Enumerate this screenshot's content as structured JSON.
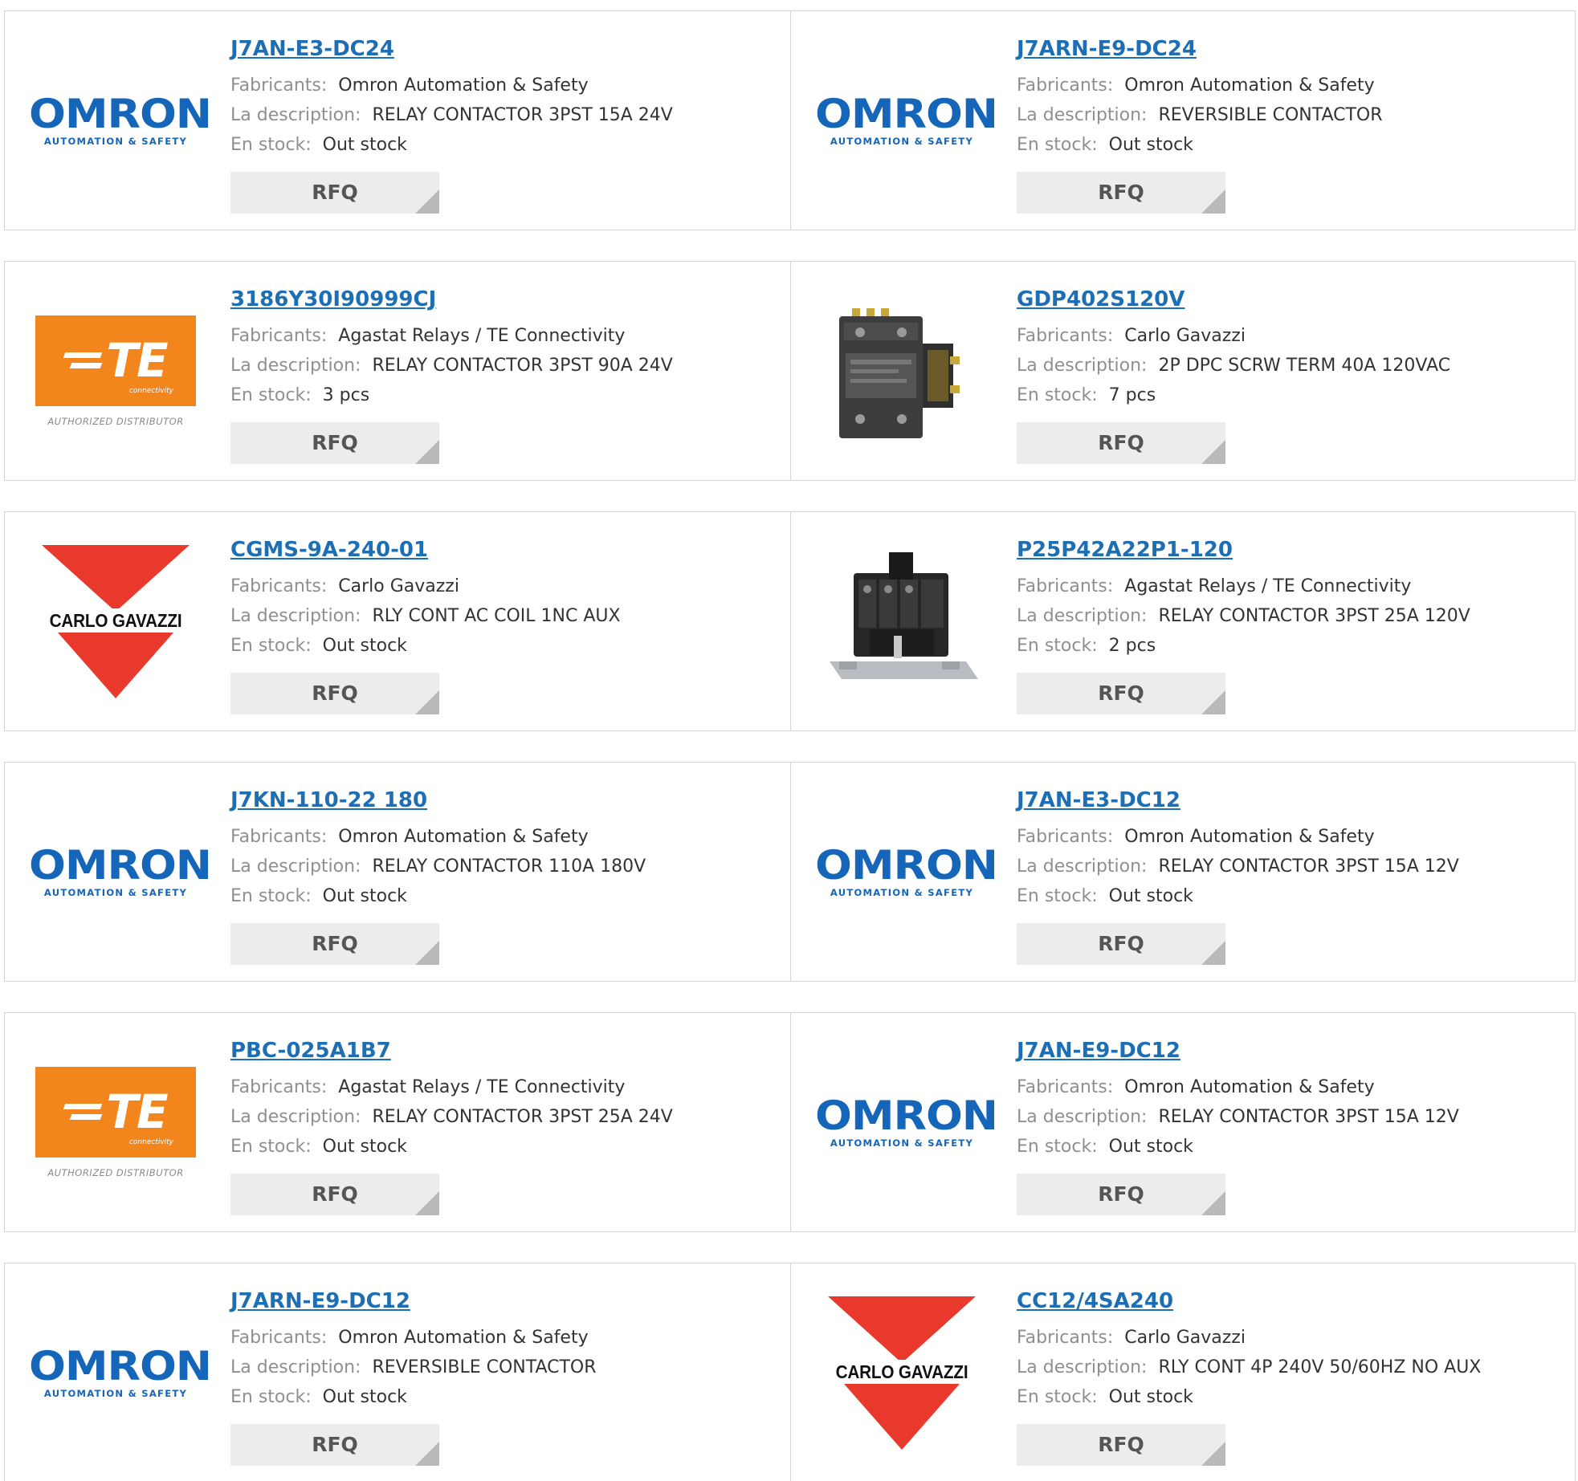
{
  "labels": {
    "manufacturer": "Fabricants:",
    "description": "La description:",
    "stock": "En stock:",
    "rfq": "RFQ"
  },
  "logos": {
    "omron": {
      "wordmark": "OMRON",
      "tagline": "AUTOMATION & SAFETY",
      "color": "#1565b9"
    },
    "te": {
      "mark": "TE",
      "tagline": "connectivity",
      "caption": "AUTHORIZED DISTRIBUTOR",
      "color": "#f3851d"
    },
    "carlo": {
      "name": "CARLO GAVAZZI",
      "color": "#e8392c"
    }
  },
  "accent_color": "#1e6eb4",
  "products": [
    {
      "part": "J7AN-E3-DC24",
      "manufacturer": "Omron Automation & Safety",
      "description": "RELAY CONTACTOR 3PST 15A 24V",
      "stock": "Out stock",
      "logo": "omron"
    },
    {
      "part": "J7ARN-E9-DC24",
      "manufacturer": "Omron Automation & Safety",
      "description": "REVERSIBLE CONTACTOR",
      "stock": "Out stock",
      "logo": "omron"
    },
    {
      "part": "3186Y30I90999CJ",
      "manufacturer": "Agastat Relays / TE Connectivity",
      "description": "RELAY CONTACTOR 3PST 90A 24V",
      "stock": "3 pcs",
      "logo": "te"
    },
    {
      "part": "GDP402S120V",
      "manufacturer": "Carlo Gavazzi",
      "description": "2P DPC SCRW TERM 40A 120VAC",
      "stock": "7 pcs",
      "logo": "photo-contactor-flat"
    },
    {
      "part": "CGMS-9A-240-01",
      "manufacturer": "Carlo Gavazzi",
      "description": "RLY CONT AC COIL 1NC AUX",
      "stock": "Out stock",
      "logo": "carlo"
    },
    {
      "part": "P25P42A22P1-120",
      "manufacturer": "Agastat Relays / TE Connectivity",
      "description": "RELAY CONTACTOR 3PST 25A 120V",
      "stock": "2 pcs",
      "logo": "photo-contactor-base"
    },
    {
      "part": "J7KN-110-22 180",
      "manufacturer": "Omron Automation & Safety",
      "description": "RELAY CONTACTOR 110A 180V",
      "stock": "Out stock",
      "logo": "omron"
    },
    {
      "part": "J7AN-E3-DC12",
      "manufacturer": "Omron Automation & Safety",
      "description": "RELAY CONTACTOR 3PST 15A 12V",
      "stock": "Out stock",
      "logo": "omron"
    },
    {
      "part": "PBC-025A1B7",
      "manufacturer": "Agastat Relays / TE Connectivity",
      "description": "RELAY CONTACTOR 3PST 25A 24V",
      "stock": "Out stock",
      "logo": "te"
    },
    {
      "part": "J7AN-E9-DC12",
      "manufacturer": "Omron Automation & Safety",
      "description": "RELAY CONTACTOR 3PST 15A 12V",
      "stock": "Out stock",
      "logo": "omron"
    },
    {
      "part": "J7ARN-E9-DC12",
      "manufacturer": "Omron Automation & Safety",
      "description": "REVERSIBLE CONTACTOR",
      "stock": "Out stock",
      "logo": "omron"
    },
    {
      "part": "CC12/4SA240",
      "manufacturer": "Carlo Gavazzi",
      "description": "RLY CONT 4P 240V 50/60HZ NO AUX",
      "stock": "Out stock",
      "logo": "carlo"
    }
  ]
}
